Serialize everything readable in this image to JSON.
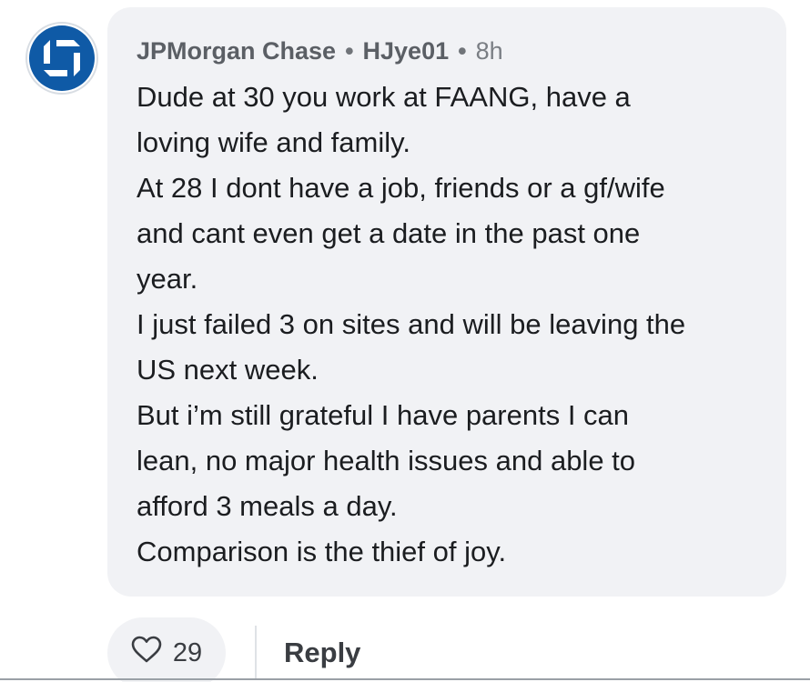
{
  "comment": {
    "author": "JPMorgan Chase",
    "separator": "•",
    "handle": "HJye01",
    "time": "8h",
    "lines": [
      "Dude at 30 you work at FAANG, have a",
      "loving wife and family.",
      "At 28 I dont have a job, friends or a gf/wife",
      "and cant even get a date in the past one",
      "year.",
      "I just failed 3 on sites and will be leaving the",
      "US next week.",
      "But i’m still grateful I have parents I can",
      "lean, no major health issues and able to",
      "afford 3 meals a day.",
      "Comparison is the thief of joy."
    ]
  },
  "actions": {
    "like_count": "29",
    "like_icon": "heart-outline-icon",
    "reply_label": "Reply"
  },
  "colors": {
    "brand_blue": "#0f5aa6",
    "bubble_bg": "#f1f2f5"
  }
}
